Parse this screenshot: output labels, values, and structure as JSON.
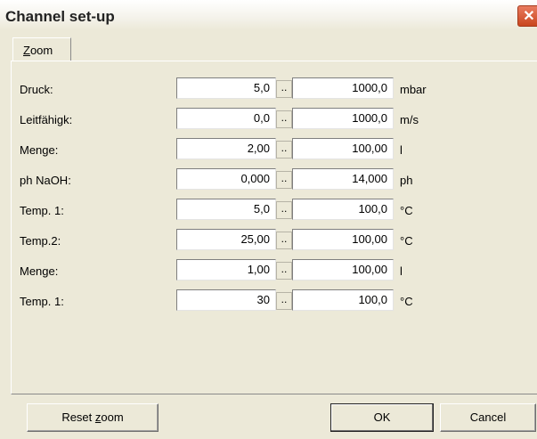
{
  "window": {
    "title": "Channel set-up",
    "close_glyph": "✕"
  },
  "tab": {
    "mnemonic": "Z",
    "rest": "oom"
  },
  "rows": [
    {
      "label": "Druck:",
      "min": "5,0",
      "max": "1000,0",
      "unit": "mbar"
    },
    {
      "label": "Leitfähigk:",
      "min": "0,0",
      "max": "1000,0",
      "unit": "m/s"
    },
    {
      "label": "Menge:",
      "min": "2,00",
      "max": "100,00",
      "unit": "l"
    },
    {
      "label": "ph NaOH:",
      "min": "0,000",
      "max": "14,000",
      "unit": "ph"
    },
    {
      "label": "Temp. 1:",
      "min": "5,0",
      "max": "100,0",
      "unit": "°C"
    },
    {
      "label": "Temp.2:",
      "min": "25,00",
      "max": "100,00",
      "unit": "°C"
    },
    {
      "label": "Menge:",
      "min": "1,00",
      "max": "100,00",
      "unit": "l"
    },
    {
      "label": "Temp. 1:",
      "min": "30",
      "max": "100,0",
      "unit": "°C"
    }
  ],
  "range_separator": "..",
  "buttons": {
    "reset_prefix": "Reset ",
    "reset_mnemonic": "z",
    "reset_suffix": "oom",
    "ok": "OK",
    "cancel": "Cancel"
  }
}
